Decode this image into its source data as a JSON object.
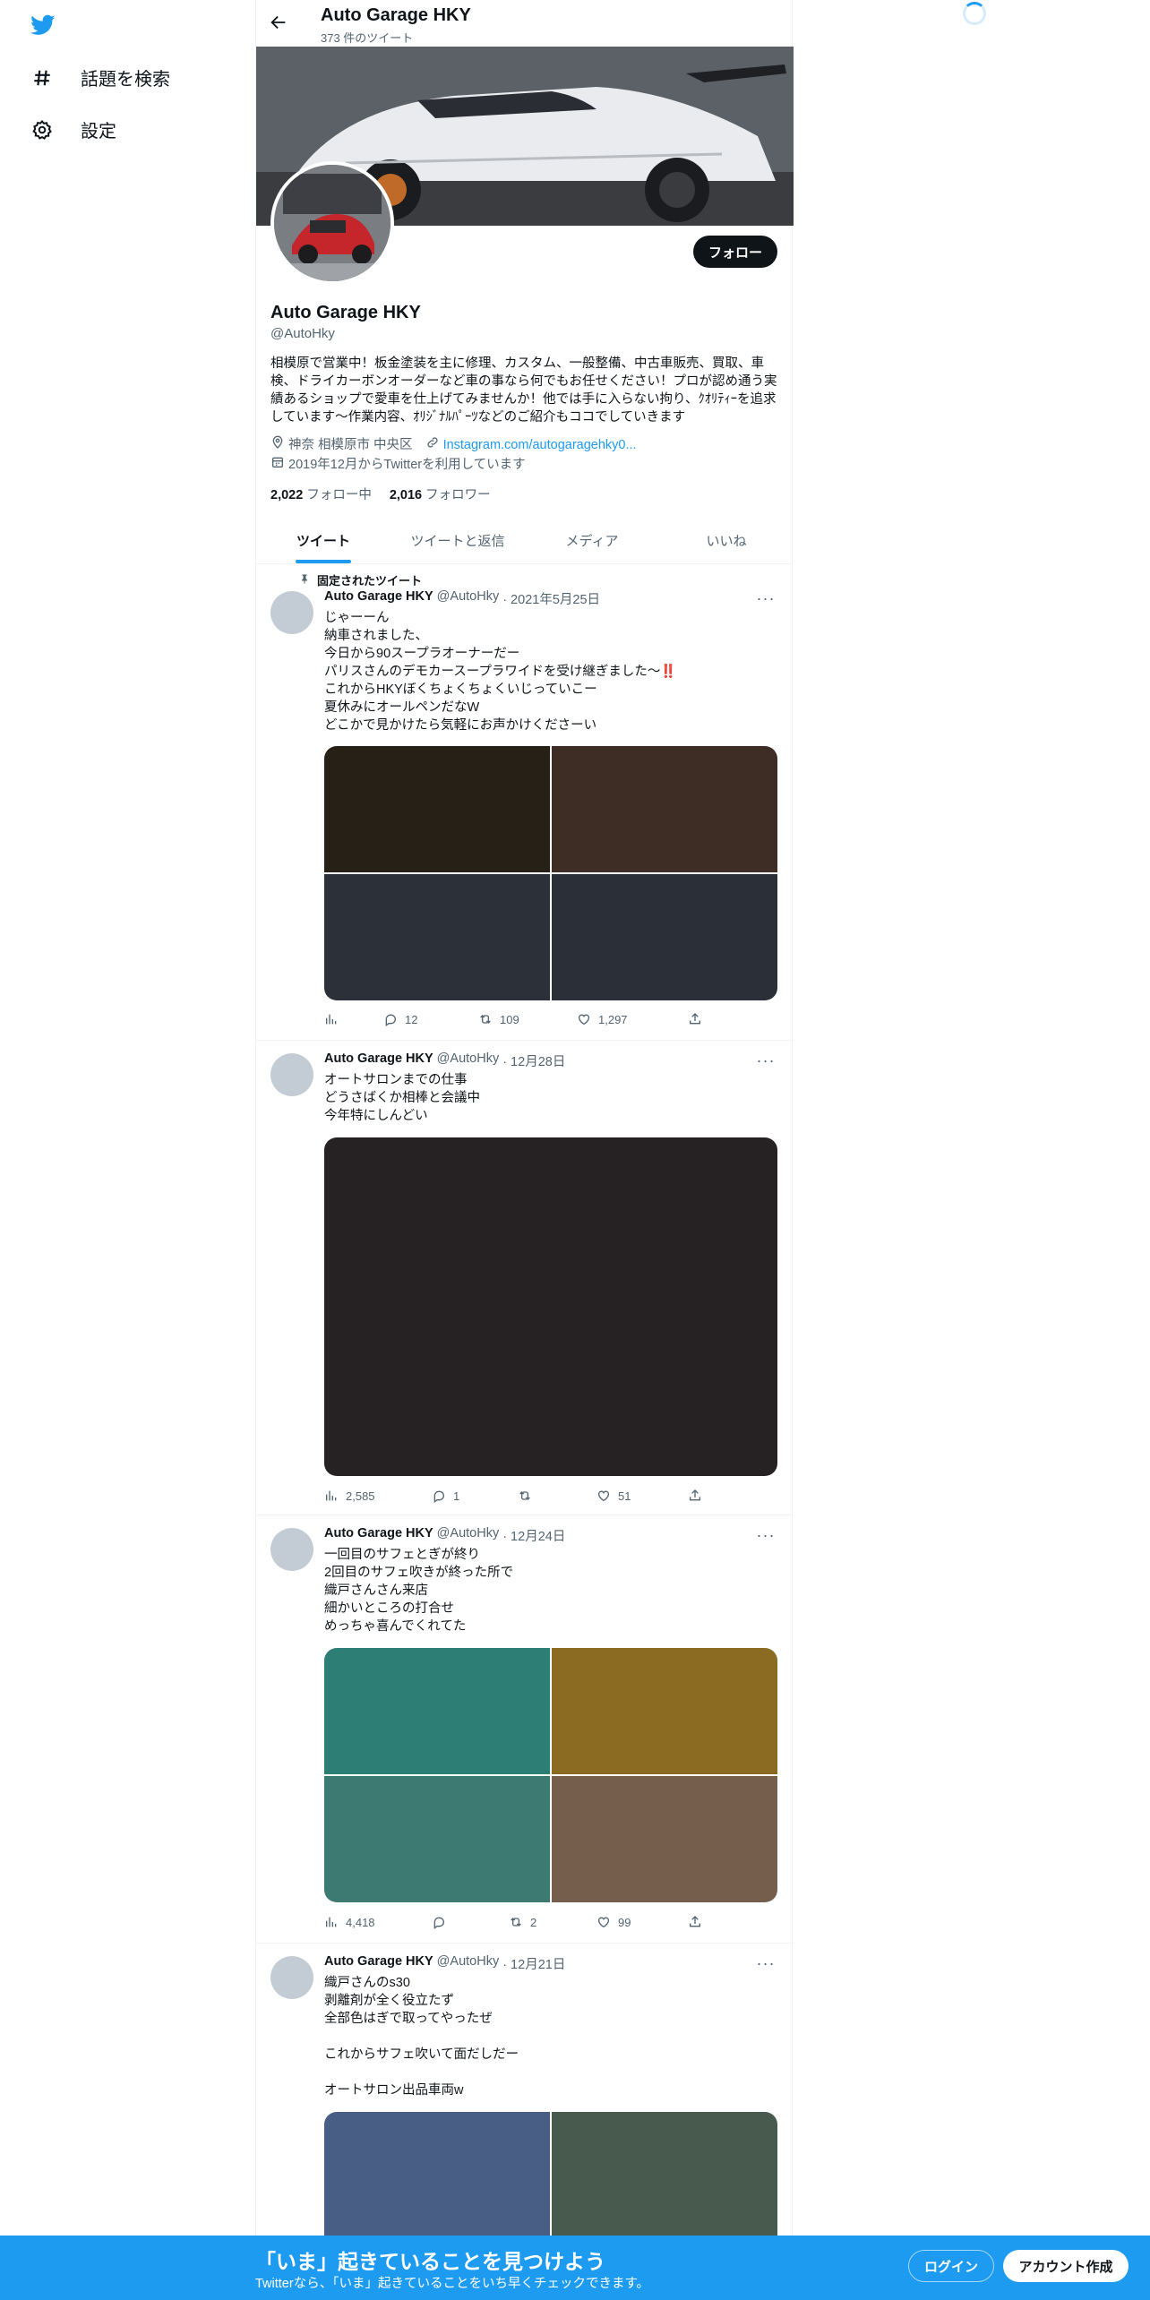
{
  "sidebar": {
    "logo": "twitter-bird-icon",
    "items": [
      {
        "icon": "hashtag-icon",
        "label": "話題を検索"
      },
      {
        "icon": "gear-icon",
        "label": "設定"
      }
    ]
  },
  "header": {
    "title": "Auto Garage HKY",
    "subtitle": "373 件のツイート"
  },
  "profile": {
    "follow_label": "フォロー",
    "name": "Auto Garage HKY",
    "handle": "@AutoHky",
    "bio": "相模原で営業中！板金塗装を主に修理、カスタム、一般整備、中古車販売、買取、車検、ドライカーボンオーダーなど車の事なら何でもお任せください！プロが認め通う実績あるショップで愛車を仕上げてみませんか！他では手に入らない拘り、ｸｵﾘﾃｨｰを追求しています〜作業内容、ｵﾘｼﾞﾅﾙﾊﾟｰﾂなどのご紹介もココでしていきます",
    "location": "神奈 相模原市 中央区",
    "link": "Instagram.com/autogaragehky0...",
    "joined": "2019年12月からTwitterを利用しています",
    "following_count": "2,022",
    "following_label": "フォロー中",
    "followers_count": "2,016",
    "followers_label": "フォロワー"
  },
  "tabs": [
    "ツイート",
    "ツイートと返信",
    "メディア",
    "いいね"
  ],
  "tweets": [
    {
      "pinned_label": "固定されたツイート",
      "name": "Auto Garage HKY",
      "handle": "@AutoHky",
      "date": "· 2021年5月25日",
      "text": "じゃーーん\n納車されました、\n今日から90スープラオーナーだー\nパリスさんのデモカースープラワイドを受け継ぎました～‼️\nこれからHKYぼくちょくちょくいじっていこー\n夏休みにオールペンだなW\nどこかで見かけたら気軽にお声かけくださーい",
      "media_colors": [
        "#272016",
        "#3d2d24",
        "#2c3038",
        "#2b2f37"
      ],
      "views": "",
      "replies": "12",
      "retweets": "109",
      "likes": "1,297"
    },
    {
      "name": "Auto Garage HKY",
      "handle": "@AutoHky",
      "date": "· 12月28日",
      "text": "オートサロンまでの仕事\nどうさばくか相棒と会議中\n今年特にしんどい",
      "media_colors": [
        "#262122"
      ],
      "views": "2,585",
      "replies": "1",
      "retweets": "",
      "likes": "51"
    },
    {
      "name": "Auto Garage HKY",
      "handle": "@AutoHky",
      "date": "· 12月24日",
      "text": "一回目のサフェとぎが終り\n2回目のサフェ吹きが終った所で\n織戸さんさん来店\n細かいところの打合せ\nめっちゃ喜んでくれてた",
      "media_colors": [
        "#2d7e75",
        "#8b6b22",
        "#3c7a72",
        "#765e4c"
      ],
      "views": "4,418",
      "replies": "",
      "retweets": "2",
      "likes": "99"
    },
    {
      "name": "Auto Garage HKY",
      "handle": "@AutoHky",
      "date": "· 12月21日",
      "text": "織戸さんのs30\n剥離剤が全く役立たず\n全部色はぎで取ってやったぜ\n\nこれからサフェ吹いて面だしだー\n\nオートサロン出品車両w",
      "media_colors": [
        "#485e85",
        "#48594e",
        "#3a3d48",
        "#3b3f46"
      ]
    }
  ],
  "bottom_bar": {
    "title": "「いま」起きていることを見つけよう",
    "subtitle": "Twitterなら、「いま」起きていることをいち早くチェックできます。",
    "login_label": "ログイン",
    "signup_label": "アカウント作成"
  },
  "colors": {
    "accent": "#1d9bf0",
    "text": "#0f1419",
    "muted": "#536471"
  }
}
